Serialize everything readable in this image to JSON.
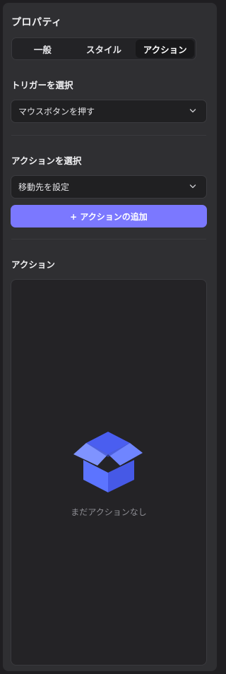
{
  "panel": {
    "title": "プロパティ",
    "tabs": [
      {
        "label": "一般",
        "active": false
      },
      {
        "label": "スタイル",
        "active": false
      },
      {
        "label": "アクション",
        "active": true
      }
    ]
  },
  "trigger": {
    "label": "トリガーを選択",
    "value": "マウスボタンを押す"
  },
  "action_select": {
    "label": "アクションを選択",
    "value": "移動先を設定",
    "add_button": "+ アクションの追加"
  },
  "actions": {
    "label": "アクション",
    "empty_text": "まだアクションなし"
  },
  "colors": {
    "accent": "#7b78ff",
    "panel_bg": "#2f2f32",
    "box_icon": "#5a73ff"
  },
  "icons": {
    "dropdown": "chevron-down-icon",
    "empty_state": "open-box-icon"
  }
}
